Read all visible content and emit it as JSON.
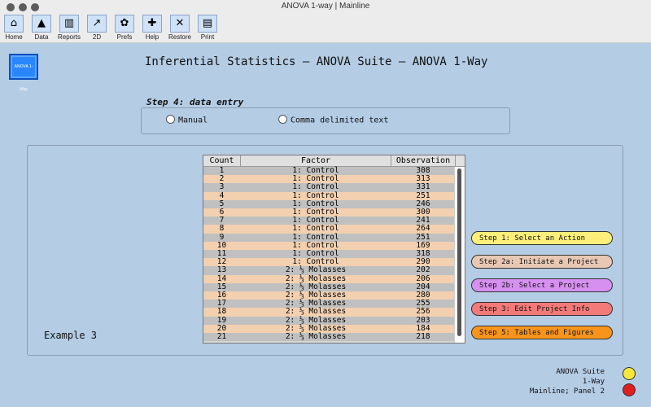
{
  "window": {
    "title": "ANOVA 1-way | Mainline"
  },
  "toolbar": [
    {
      "label": "Home",
      "icon": "home-icon",
      "glyph": "⌂"
    },
    {
      "label": "Data",
      "icon": "tree-icon",
      "glyph": "▲"
    },
    {
      "label": "Reports",
      "icon": "building-icon",
      "glyph": "▥"
    },
    {
      "label": "2D",
      "icon": "chart-icon",
      "glyph": "↗"
    },
    {
      "label": "Prefs",
      "icon": "leaf-icon",
      "glyph": "✿"
    },
    {
      "label": "Help",
      "icon": "helmet-icon",
      "glyph": "✚"
    },
    {
      "label": "Restore",
      "icon": "tools-icon",
      "glyph": "✕"
    },
    {
      "label": "Print",
      "icon": "printer-icon",
      "glyph": "▤"
    }
  ],
  "logo": {
    "text": "ANOVA 1-Way"
  },
  "header": {
    "title": "Inferential Statistics — ANOVA Suite — ANOVA 1-Way"
  },
  "step4": {
    "label": "Step 4: data entry",
    "options": [
      "Manual",
      "Comma delimited text"
    ]
  },
  "panel": {
    "example_label": "Example 3"
  },
  "table": {
    "columns": [
      "Count",
      "Factor",
      "Observation"
    ],
    "rows": [
      [
        "1",
        "1: Control",
        "308"
      ],
      [
        "2",
        "1: Control",
        "313"
      ],
      [
        "3",
        "1: Control",
        "331"
      ],
      [
        "4",
        "1: Control",
        "251"
      ],
      [
        "5",
        "1: Control",
        "246"
      ],
      [
        "6",
        "1: Control",
        "300"
      ],
      [
        "7",
        "1: Control",
        "241"
      ],
      [
        "8",
        "1: Control",
        "264"
      ],
      [
        "9",
        "1: Control",
        "251"
      ],
      [
        "10",
        "1: Control",
        "169"
      ],
      [
        "11",
        "1: Control",
        "318"
      ],
      [
        "12",
        "1: Control",
        "290"
      ],
      [
        "13",
        "2: ⅓ Molasses",
        "202"
      ],
      [
        "14",
        "2: ⅓ Molasses",
        "206"
      ],
      [
        "15",
        "2: ⅓ Molasses",
        "204"
      ],
      [
        "16",
        "2: ⅓ Molasses",
        "280"
      ],
      [
        "17",
        "2: ⅓ Molasses",
        "255"
      ],
      [
        "18",
        "2: ⅓ Molasses",
        "256"
      ],
      [
        "19",
        "2: ⅓ Molasses",
        "203"
      ],
      [
        "20",
        "2: ⅓ Molasses",
        "184"
      ],
      [
        "21",
        "2: ⅓ Molasses",
        "218"
      ]
    ]
  },
  "steps": [
    {
      "label": "Step 1: Select an Action",
      "color": "#ffef7a"
    },
    {
      "label": "Step 2a: Initiate a Project",
      "color": "#e8c8b4"
    },
    {
      "label": "Step 2b: Select a Project",
      "color": "#d690f0"
    },
    {
      "label": "Step 3: Edit Project Info",
      "color": "#f47a7a"
    },
    {
      "label": "Step 5: Tables and Figures",
      "color": "#f8941c"
    }
  ],
  "status": {
    "line1": "ANOVA Suite",
    "line2": "1-Way",
    "line3": "Mainline; Panel 2",
    "dot1_color": "#f5e83a",
    "dot2_color": "#e01e1e"
  }
}
